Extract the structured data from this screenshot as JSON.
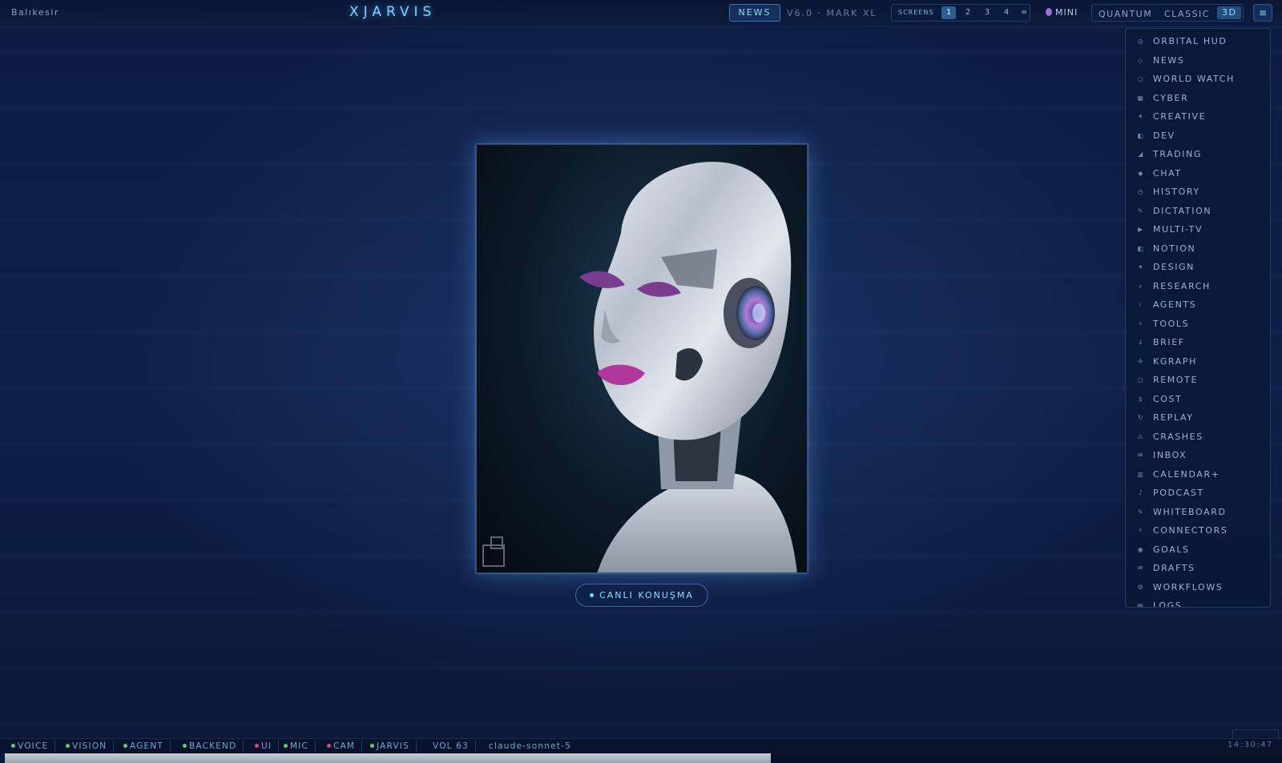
{
  "header": {
    "location": "Balıkesir",
    "brand": "XJARVIS",
    "news_label": "NEWS",
    "version": "V6.0 · MARK XL",
    "screens_label": "SCREENS",
    "screens": [
      "1",
      "2",
      "3",
      "4",
      "∞"
    ],
    "active_screen": "1",
    "mini_label": "MINI",
    "modes": [
      "QUANTUM",
      "CLASSIC",
      "3D"
    ],
    "active_mode": "3D",
    "menu_icon": "hamburger-icon",
    "menu_glyph": "≡"
  },
  "sidemenu": {
    "items": [
      {
        "label": "ORBITAL HUD",
        "icon": "orbit-icon",
        "glyph": "◎"
      },
      {
        "label": "NEWS",
        "icon": "news-icon",
        "glyph": "◇"
      },
      {
        "label": "WORLD WATCH",
        "icon": "globe-icon",
        "glyph": "○"
      },
      {
        "label": "CYBER",
        "icon": "shield-icon",
        "glyph": "▦"
      },
      {
        "label": "CREATIVE",
        "icon": "sparkle-icon",
        "glyph": "✦"
      },
      {
        "label": "DEV",
        "icon": "code-icon",
        "glyph": "◧"
      },
      {
        "label": "TRADING",
        "icon": "chart-icon",
        "glyph": "◢"
      },
      {
        "label": "CHAT",
        "icon": "chat-icon",
        "glyph": "◆"
      },
      {
        "label": "HISTORY",
        "icon": "clock-icon",
        "glyph": "◷"
      },
      {
        "label": "DICTATION",
        "icon": "pen-icon",
        "glyph": "✎"
      },
      {
        "label": "MULTI-TV",
        "icon": "play-icon",
        "glyph": "▶"
      },
      {
        "label": "NOTION",
        "icon": "notion-icon",
        "glyph": "◧"
      },
      {
        "label": "DESIGN",
        "icon": "design-icon",
        "glyph": "✦"
      },
      {
        "label": "RESEARCH",
        "icon": "search-icon",
        "glyph": "⌕"
      },
      {
        "label": "AGENTS",
        "icon": "agents-icon",
        "glyph": "⁞"
      },
      {
        "label": "TOOLS",
        "icon": "tools-icon",
        "glyph": "✧"
      },
      {
        "label": "BRIEF",
        "icon": "brief-icon",
        "glyph": "↓"
      },
      {
        "label": "KGRAPH",
        "icon": "graph-icon",
        "glyph": "✢"
      },
      {
        "label": "REMOTE",
        "icon": "remote-icon",
        "glyph": "○"
      },
      {
        "label": "COST",
        "icon": "dollar-icon",
        "glyph": "$"
      },
      {
        "label": "REPLAY",
        "icon": "replay-icon",
        "glyph": "↻"
      },
      {
        "label": "CRASHES",
        "icon": "warning-icon",
        "glyph": "⚠"
      },
      {
        "label": "INBOX",
        "icon": "mail-icon",
        "glyph": "✉"
      },
      {
        "label": "CALENDAR+",
        "icon": "calendar-icon",
        "glyph": "▥"
      },
      {
        "label": "PODCAST",
        "icon": "music-icon",
        "glyph": "♪"
      },
      {
        "label": "WHITEBOARD",
        "icon": "whiteboard-icon",
        "glyph": "✎"
      },
      {
        "label": "CONNECTORS",
        "icon": "lightning-icon",
        "glyph": "⚡"
      },
      {
        "label": "GOALS",
        "icon": "target-icon",
        "glyph": "◉"
      },
      {
        "label": "DRAFTS",
        "icon": "drafts-icon",
        "glyph": "✉"
      },
      {
        "label": "WORKFLOWS",
        "icon": "gear-icon",
        "glyph": "⚙"
      },
      {
        "label": "LOGS",
        "icon": "scroll-icon",
        "glyph": "▤"
      }
    ]
  },
  "main": {
    "live_button": "CANLI KONUŞMA",
    "portrait_icon": "robot-portrait-icon"
  },
  "statusbar": {
    "items": [
      {
        "label": "VOICE",
        "status_color": "#4fd27a"
      },
      {
        "label": "VISION",
        "status_color": "#4fd27a"
      },
      {
        "label": "AGENT",
        "status_color": "#4fd27a"
      },
      {
        "label": "BACKEND",
        "status_color": "#4fd27a"
      },
      {
        "label": "UI",
        "status_color": "#e0407a"
      },
      {
        "label": "MIC",
        "status_color": "#4fd27a"
      },
      {
        "label": "CAM",
        "status_color": "#e0407a"
      },
      {
        "label": "JARVIS",
        "status_color": "#4fd27a"
      }
    ],
    "volume": "VOL 63",
    "model": "claude-sonnet-5",
    "clock": "14:30:47",
    "progress": 0.6
  },
  "colors": {
    "accent": "#8fdcff",
    "background": "#0e1c42"
  }
}
